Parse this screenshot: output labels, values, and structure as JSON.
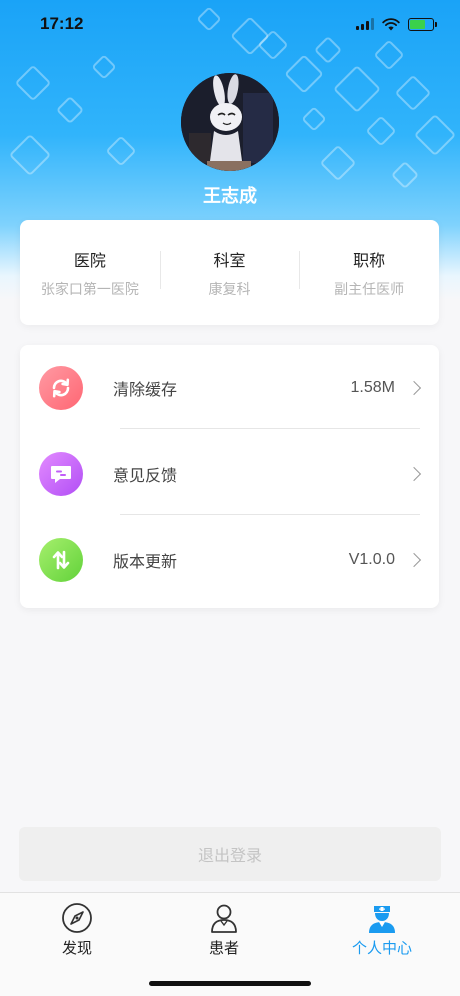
{
  "status_bar": {
    "time": "17:12",
    "signal_icon": "signal-bars-icon",
    "wifi_icon": "wifi-icon",
    "battery_icon": "battery-charging-icon",
    "battery_level": 0.7
  },
  "profile": {
    "avatar_icon": "avatar-rabbit-figure",
    "name": "王志成"
  },
  "info": [
    {
      "title": "医院",
      "value": "张家口第一医院"
    },
    {
      "title": "科室",
      "value": "康复科"
    },
    {
      "title": "职称",
      "value": "副主任医师"
    }
  ],
  "menu": [
    {
      "label": "清除缓存",
      "value": "1.58M",
      "icon": "refresh-icon",
      "color_start": "#ff9aa3",
      "color_end": "#ff6673"
    },
    {
      "label": "意见反馈",
      "value": "",
      "icon": "feedback-chat-icon",
      "color_start": "#e38bff",
      "color_end": "#b14ef5"
    },
    {
      "label": "版本更新",
      "value": "V1.0.0",
      "icon": "update-arrows-icon",
      "color_start": "#a6ef6d",
      "color_end": "#62d23a"
    }
  ],
  "logout_label": "退出登录",
  "tabs": [
    {
      "label": "发现",
      "icon": "compass-icon",
      "active": false
    },
    {
      "label": "患者",
      "icon": "patient-icon",
      "active": false
    },
    {
      "label": "个人中心",
      "icon": "doctor-icon",
      "active": true
    }
  ],
  "colors": {
    "accent": "#1a9bf0",
    "header_top": "#1aa3f7"
  }
}
